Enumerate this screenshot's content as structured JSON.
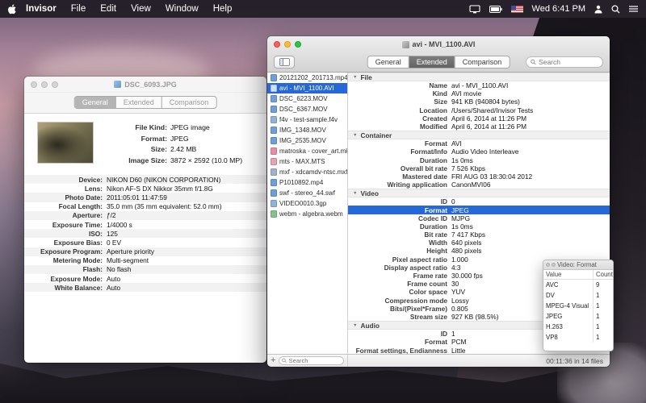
{
  "colors": {
    "selection": "#2668d8"
  },
  "menu_bar": {
    "items": [
      "Invisor",
      "File",
      "Edit",
      "View",
      "Window",
      "Help"
    ],
    "clock": "Wed 6:41 PM"
  },
  "left_window": {
    "title": "DSC_6093.JPG",
    "tabs": [
      {
        "label": "General",
        "selected": true
      },
      {
        "label": "Extended"
      },
      {
        "label": "Comparison"
      }
    ],
    "summary": [
      {
        "label": "File Kind:",
        "value": "JPEG image"
      },
      {
        "label": "Format:",
        "value": "JPEG"
      },
      {
        "label": "Size:",
        "value": "2.42 MB"
      },
      {
        "label": "Image Size:",
        "value": "3872 × 2592 (10.0 MP)"
      }
    ],
    "details": [
      {
        "label": "Device:",
        "value": "NIKON D60 (NIKON CORPORATION)"
      },
      {
        "label": "Lens:",
        "value": "Nikon AF-S DX Nikkor 35mm f/1.8G"
      },
      {
        "label": "Photo Date:",
        "value": "2011:05:01 11:47:59"
      },
      {
        "label": "Focal Length:",
        "value": "35.0 mm (35 mm equivalent: 52.0 mm)"
      },
      {
        "label": "Aperture:",
        "value": "ƒ/2"
      },
      {
        "label": "Exposure Time:",
        "value": "1/4000 s"
      },
      {
        "label": "ISO:",
        "value": "125"
      },
      {
        "label": "Exposure Bias:",
        "value": "0 EV"
      },
      {
        "label": "Exposure Program:",
        "value": "Aperture priority"
      },
      {
        "label": "Metering Mode:",
        "value": "Multi-segment"
      },
      {
        "label": "Flash:",
        "value": "No flash"
      },
      {
        "label": "Exposure Mode:",
        "value": "Auto"
      },
      {
        "label": "White Balance:",
        "value": "Auto"
      }
    ]
  },
  "right_window": {
    "title": "avi - MVI_1100.AVI",
    "tabs": [
      {
        "label": "General"
      },
      {
        "label": "Extended",
        "selected": true
      },
      {
        "label": "Comparison"
      }
    ],
    "search_placeholder": "Search",
    "sidebar": {
      "add_label": "+",
      "search_placeholder": "Search",
      "files": [
        {
          "name": "20121202_201713.mp4",
          "icon_color": "#6f9fd8"
        },
        {
          "name": "avi - MVI_1100.AVI",
          "icon_color": "#cfe0f5",
          "selected": true
        },
        {
          "name": "DSC_6223.MOV",
          "icon_color": "#6f9fd8"
        },
        {
          "name": "DSC_6367.MOV",
          "icon_color": "#6f9fd8"
        },
        {
          "name": "f4v - test-sample.f4v",
          "icon_color": "#8fb3d8"
        },
        {
          "name": "IMG_1348.MOV",
          "icon_color": "#6f9fd8"
        },
        {
          "name": "IMG_2535.MOV",
          "icon_color": "#6f9fd8"
        },
        {
          "name": "matroska - cover_art.mkv",
          "icon_color": "#e88ca6"
        },
        {
          "name": "mts - MAX.MTS",
          "icon_color": "#e8a0b4"
        },
        {
          "name": "mxf - xdcamdv-ntsc.mxf",
          "icon_color": "#9fb3c8"
        },
        {
          "name": "P1010892.mp4",
          "icon_color": "#6f9fd8"
        },
        {
          "name": "swf - stereo_44.swf",
          "icon_color": "#6f9fd8"
        },
        {
          "name": "VIDEO0010.3gp",
          "icon_color": "#8fb3d8"
        },
        {
          "name": "webm - algebra.webm",
          "icon_color": "#86c28c"
        }
      ]
    },
    "sections": [
      {
        "title": "File",
        "rows": [
          {
            "label": "Name",
            "value": "avi - MVI_1100.AVI"
          },
          {
            "label": "Kind",
            "value": "AVI movie"
          },
          {
            "label": "Size",
            "value": "941 KB (940804 bytes)"
          },
          {
            "label": "Location",
            "value": "/Users/Shared/Invisor Tests"
          },
          {
            "label": "Created",
            "value": "April 6, 2014 at 11:26 PM"
          },
          {
            "label": "Modified",
            "value": "April 6, 2014 at 11:26 PM"
          }
        ]
      },
      {
        "title": "Container",
        "rows": [
          {
            "label": "Format",
            "value": "AVI"
          },
          {
            "label": "Format/Info",
            "value": "Audio Video Interleave"
          },
          {
            "label": "Duration",
            "value": "1s 0ms"
          },
          {
            "label": "Overall bit rate",
            "value": "7 526 Kbps"
          },
          {
            "label": "Mastered date",
            "value": "FRI AUG 03 18:30:04 2012"
          },
          {
            "label": "Writing application",
            "value": "CanonMVI06"
          }
        ]
      },
      {
        "title": "Video",
        "rows": [
          {
            "label": "ID",
            "value": "0"
          },
          {
            "label": "Format",
            "value": "JPEG",
            "selected": true
          },
          {
            "label": "Codec ID",
            "value": "MJPG"
          },
          {
            "label": "Duration",
            "value": "1s 0ms"
          },
          {
            "label": "Bit rate",
            "value": "7 417 Kbps"
          },
          {
            "label": "Width",
            "value": "640 pixels"
          },
          {
            "label": "Height",
            "value": "480 pixels"
          },
          {
            "label": "Pixel aspect ratio",
            "value": "1.000"
          },
          {
            "label": "Display aspect ratio",
            "value": "4:3"
          },
          {
            "label": "Frame rate",
            "value": "30.000 fps"
          },
          {
            "label": "Frame count",
            "value": "30"
          },
          {
            "label": "Color space",
            "value": "YUV"
          },
          {
            "label": "Compression mode",
            "value": "Lossy"
          },
          {
            "label": "Bits/(Pixel*Frame)",
            "value": "0.805"
          },
          {
            "label": "Stream size",
            "value": "927 KB (98.5%)"
          }
        ]
      },
      {
        "title": "Audio",
        "rows": [
          {
            "label": "ID",
            "value": "1"
          },
          {
            "label": "Format",
            "value": "PCM"
          },
          {
            "label": "Format settings, Endianness",
            "value": "Little"
          }
        ]
      }
    ],
    "status": "00:11:36 in 14 files"
  },
  "popover": {
    "title": "Video: Format",
    "columns": [
      "Value",
      "Count"
    ],
    "rows": [
      {
        "value": "AVC",
        "count": "9"
      },
      {
        "value": "DV",
        "count": "1"
      },
      {
        "value": "MPEG-4 Visual",
        "count": "1"
      },
      {
        "value": "JPEG",
        "count": "1"
      },
      {
        "value": "H.263",
        "count": "1"
      },
      {
        "value": "VP8",
        "count": "1"
      }
    ]
  }
}
